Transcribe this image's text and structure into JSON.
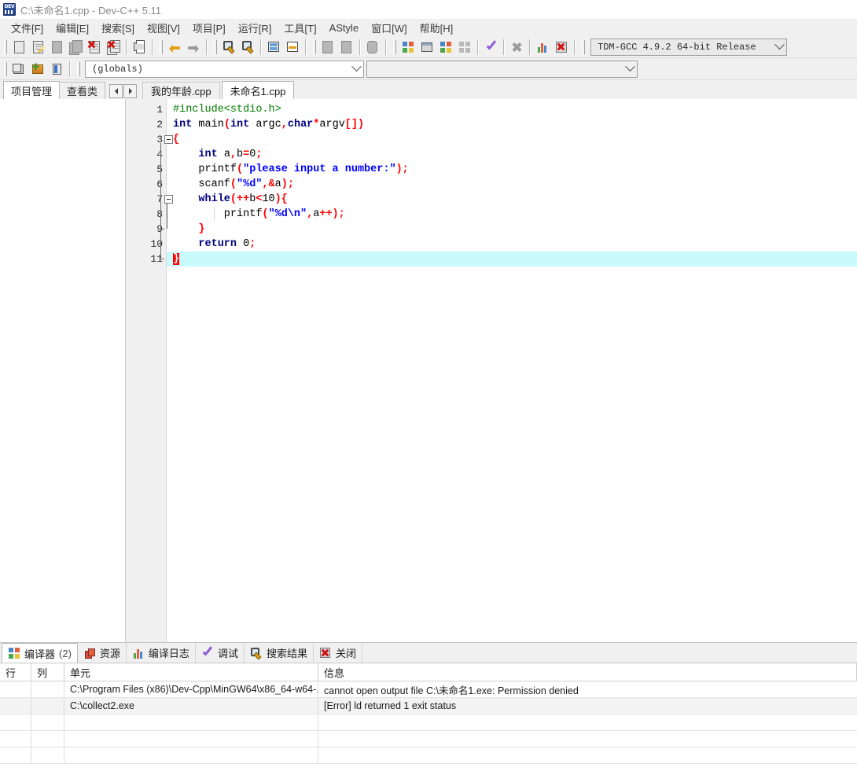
{
  "titlebar": {
    "title": "C:\\未命名1.cpp - Dev-C++ 5.11",
    "icon": "dev-cpp-icon"
  },
  "menubar": {
    "items": [
      {
        "label": "文件[F]",
        "name": "menu-file"
      },
      {
        "label": "编辑[E]",
        "name": "menu-edit"
      },
      {
        "label": "搜索[S]",
        "name": "menu-search"
      },
      {
        "label": "视图[V]",
        "name": "menu-view"
      },
      {
        "label": "项目[P]",
        "name": "menu-project"
      },
      {
        "label": "运行[R]",
        "name": "menu-run"
      },
      {
        "label": "工具[T]",
        "name": "menu-tools"
      },
      {
        "label": "AStyle",
        "name": "menu-astyle"
      },
      {
        "label": "窗口[W]",
        "name": "menu-window"
      },
      {
        "label": "帮助[H]",
        "name": "menu-help"
      }
    ]
  },
  "toolbar": {
    "icons": [
      "new-file-icon",
      "open-file-icon",
      "save-icon",
      "save-all-icon",
      "close-file-icon",
      "close-all-icon",
      "print-icon",
      "undo-icon",
      "redo-icon",
      "find-icon",
      "replace-icon",
      "goto-line-icon",
      "goto-function-icon",
      "back-icon",
      "forward-icon",
      "toggle-icon",
      "new-project-icon",
      "project-options-icon",
      "project-manager-icon",
      "tiles-icon",
      "compile-run-icon",
      "abort-icon",
      "profile-icon",
      "delete-profile-icon"
    ],
    "compiler_set": "TDM-GCC 4.9.2 64-bit Release",
    "scope": "(globals)",
    "scope_secondary": ""
  },
  "panel_tabs": {
    "items": [
      {
        "label": "项目管理",
        "name": "tab-project-manager",
        "active": true
      },
      {
        "label": "查看类",
        "name": "tab-class-browser",
        "active": false
      }
    ],
    "nav_prev": "◄",
    "nav_next": "►"
  },
  "editor_tabs": {
    "items": [
      {
        "label": "我的年龄.cpp",
        "name": "editor-tab-my-age",
        "active": false
      },
      {
        "label": "未命名1.cpp",
        "name": "editor-tab-untitled1",
        "active": true
      }
    ]
  },
  "editor": {
    "cursor_line": 11,
    "lines": [
      {
        "n": 1,
        "fold": "none",
        "tokens": [
          {
            "t": "#include<stdio.h>",
            "c": "pp"
          }
        ]
      },
      {
        "n": 2,
        "fold": "none",
        "tokens": [
          {
            "t": "int",
            "c": "k"
          },
          {
            "t": " main",
            "c": "id"
          },
          {
            "t": "(",
            "c": "pn"
          },
          {
            "t": "int",
            "c": "k"
          },
          {
            "t": " argc",
            "c": "id"
          },
          {
            "t": ",",
            "c": "pn"
          },
          {
            "t": "char",
            "c": "k"
          },
          {
            "t": "*",
            "c": "pn"
          },
          {
            "t": "argv",
            "c": "id"
          },
          {
            "t": "[])",
            "c": "pn"
          }
        ]
      },
      {
        "n": 3,
        "fold": "start",
        "tokens": [
          {
            "t": "{",
            "c": "pn"
          }
        ]
      },
      {
        "n": 4,
        "fold": "bar",
        "tokens": [
          {
            "t": "    ",
            "c": "id"
          },
          {
            "t": "int",
            "c": "k"
          },
          {
            "t": " a",
            "c": "id"
          },
          {
            "t": ",",
            "c": "pn"
          },
          {
            "t": "b",
            "c": "id"
          },
          {
            "t": "=",
            "c": "pn"
          },
          {
            "t": "0",
            "c": "nm"
          },
          {
            "t": ";",
            "c": "pn"
          }
        ]
      },
      {
        "n": 5,
        "fold": "bar",
        "tokens": [
          {
            "t": "    printf",
            "c": "id"
          },
          {
            "t": "(",
            "c": "pn"
          },
          {
            "t": "\"please input a number:\"",
            "c": "st"
          },
          {
            "t": ");",
            "c": "pn"
          }
        ]
      },
      {
        "n": 6,
        "fold": "bar",
        "tokens": [
          {
            "t": "    scanf",
            "c": "id"
          },
          {
            "t": "(",
            "c": "pn"
          },
          {
            "t": "\"%d\"",
            "c": "st"
          },
          {
            "t": ",",
            "c": "pn"
          },
          {
            "t": "&",
            "c": "pn"
          },
          {
            "t": "a",
            "c": "id"
          },
          {
            "t": ");",
            "c": "pn"
          }
        ]
      },
      {
        "n": 7,
        "fold": "start2",
        "tokens": [
          {
            "t": "    ",
            "c": "id"
          },
          {
            "t": "while",
            "c": "k"
          },
          {
            "t": "(++",
            "c": "pn"
          },
          {
            "t": "b",
            "c": "id"
          },
          {
            "t": "<",
            "c": "pn"
          },
          {
            "t": "10",
            "c": "nm"
          },
          {
            "t": "){",
            "c": "pn"
          }
        ]
      },
      {
        "n": 8,
        "fold": "bar2",
        "tokens": [
          {
            "t": "        printf",
            "c": "id"
          },
          {
            "t": "(",
            "c": "pn"
          },
          {
            "t": "\"%d\\n\"",
            "c": "st"
          },
          {
            "t": ",",
            "c": "pn"
          },
          {
            "t": "a",
            "c": "id"
          },
          {
            "t": "++);",
            "c": "pn"
          }
        ]
      },
      {
        "n": 9,
        "fold": "end2",
        "tokens": [
          {
            "t": "    ",
            "c": "id"
          },
          {
            "t": "}",
            "c": "pn"
          }
        ]
      },
      {
        "n": 10,
        "fold": "bar",
        "tokens": [
          {
            "t": "    ",
            "c": "id"
          },
          {
            "t": "return",
            "c": "k"
          },
          {
            "t": " ",
            "c": "id"
          },
          {
            "t": "0",
            "c": "nm"
          },
          {
            "t": ";",
            "c": "pn"
          }
        ]
      },
      {
        "n": 11,
        "fold": "end",
        "highlight": true,
        "tokens": [
          {
            "t": "}",
            "c": "brace-hi"
          }
        ]
      }
    ]
  },
  "dock": {
    "tabs": [
      {
        "label": "编译器",
        "count": "(2)",
        "icon": "compiler-icon",
        "name": "dock-tab-compiler",
        "active": true
      },
      {
        "label": "资源",
        "count": "",
        "icon": "resources-icon",
        "name": "dock-tab-resources",
        "active": false
      },
      {
        "label": "编译日志",
        "count": "",
        "icon": "compile-log-icon",
        "name": "dock-tab-log",
        "active": false
      },
      {
        "label": "调试",
        "count": "",
        "icon": "debug-icon",
        "name": "dock-tab-debug",
        "active": false
      },
      {
        "label": "搜索结果",
        "count": "",
        "icon": "search-results-icon",
        "name": "dock-tab-find",
        "active": false
      },
      {
        "label": "关闭",
        "count": "",
        "icon": "close-icon",
        "name": "dock-tab-close",
        "active": false
      }
    ],
    "table": {
      "headers": [
        "行",
        "列",
        "单元",
        "信息"
      ],
      "rows": [
        {
          "line": "",
          "col": "",
          "unit": "C:\\Program Files (x86)\\Dev-Cpp\\MinGW64\\x86_64-w64-...",
          "message": "cannot open output file C:\\未命名1.exe: Permission denied"
        },
        {
          "line": "",
          "col": "",
          "unit": "C:\\collect2.exe",
          "message": "[Error] ld returned 1 exit status"
        }
      ],
      "empty_rows": 3
    }
  },
  "colors": {
    "keyword": "#000080",
    "preprocessor": "#007f00",
    "string": "#0000ff",
    "punctuation": "#ff0000",
    "current_line": "#c9fbfd",
    "brace_match_bg": "#ff0000"
  }
}
